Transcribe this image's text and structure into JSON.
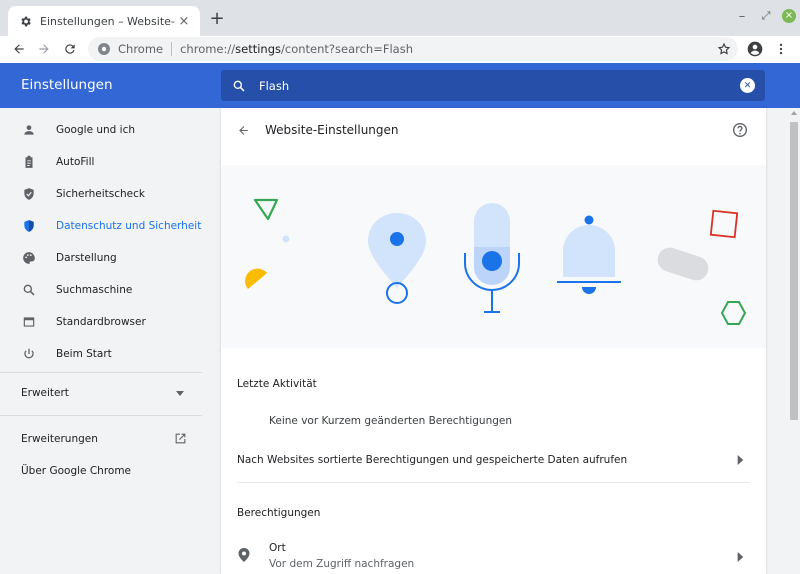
{
  "tab": {
    "title": "Einstellungen – Website-Einste",
    "close": "×"
  },
  "newtab": "+",
  "window": {
    "minimize": "–",
    "maximize": "⤢",
    "close": "×"
  },
  "omnibox": {
    "site_label": "Chrome",
    "url_prefix": "chrome://",
    "url_host": "settings",
    "url_rest": "/content?search=Flash"
  },
  "header": {
    "title": "Einstellungen",
    "search_value": "Flash"
  },
  "sidebar": {
    "items": [
      {
        "label": "Google und ich",
        "icon": "person-icon"
      },
      {
        "label": "AutoFill",
        "icon": "clipboard-icon"
      },
      {
        "label": "Sicherheitscheck",
        "icon": "shield-check-icon"
      },
      {
        "label": "Datenschutz und Sicherheit",
        "icon": "shield-icon",
        "active": true
      },
      {
        "label": "Darstellung",
        "icon": "palette-icon"
      },
      {
        "label": "Suchmaschine",
        "icon": "search-icon"
      },
      {
        "label": "Standardbrowser",
        "icon": "browser-icon"
      },
      {
        "label": "Beim Start",
        "icon": "power-icon"
      }
    ],
    "advanced": "Erweitert",
    "extensions": "Erweiterungen",
    "about": "Über Google Chrome"
  },
  "content": {
    "title": "Website-Einstellungen",
    "recent_activity": "Letzte Aktivität",
    "no_recent": "Keine vor Kurzem geänderten Berechtigungen",
    "view_permissions": "Nach Websites sortierte Berechtigungen und gespeicherte Daten aufrufen",
    "permissions": "Berechtigungen",
    "location_title": "Ort",
    "location_sub": "Vor dem Zugriff nachfragen"
  },
  "colors": {
    "accent": "#1a73e8",
    "header_blue": "#3367d6",
    "search_blue": "#254fa8"
  }
}
